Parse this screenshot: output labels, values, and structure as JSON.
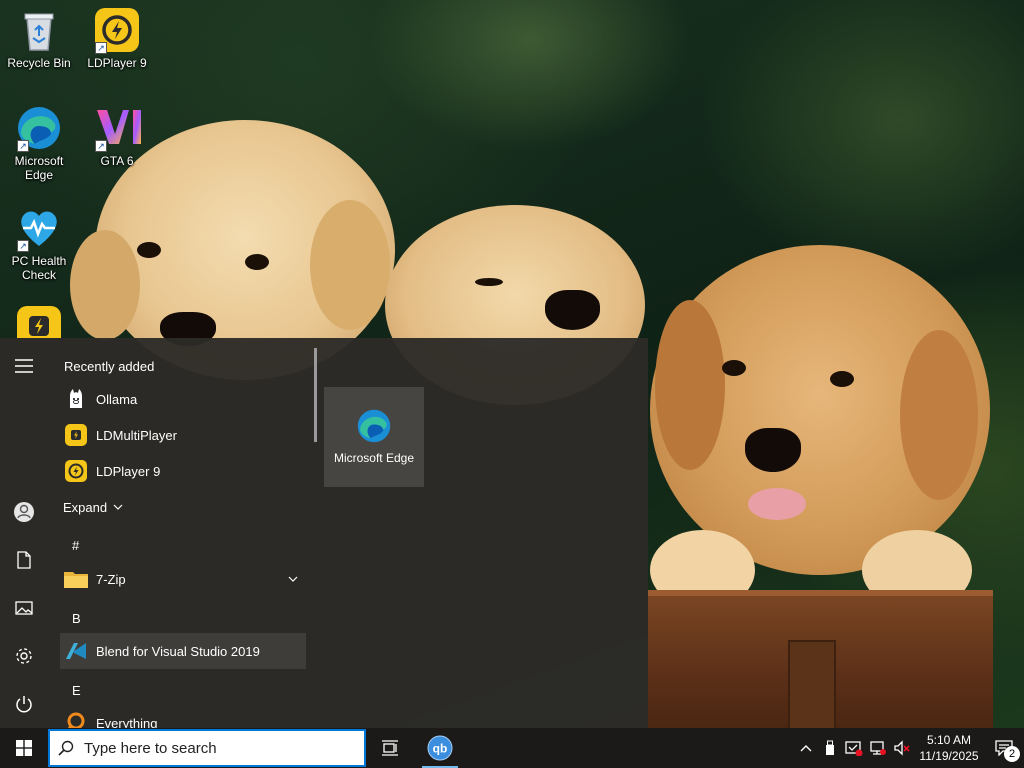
{
  "desktop": {
    "icons": [
      {
        "label": "Recycle Bin",
        "icon": "recycle-bin-icon"
      },
      {
        "label": "LDPlayer 9",
        "icon": "ldplayer-icon"
      },
      {
        "label": "Microsoft Edge",
        "icon": "edge-icon"
      },
      {
        "label": "GTA 6",
        "icon": "gta6-icon"
      },
      {
        "label": "PC Health Check",
        "icon": "pc-health-check-icon"
      },
      {
        "label": "",
        "icon": "ldmultiplayer-icon"
      }
    ]
  },
  "start_menu": {
    "rail": {
      "menu_icon": "hamburger-icon",
      "user_icon": "user-icon",
      "documents_icon": "document-icon",
      "pictures_icon": "pictures-icon",
      "settings_icon": "gear-icon",
      "power_icon": "power-icon"
    },
    "recently_added_title": "Recently added",
    "recent_apps": [
      {
        "label": "Ollama",
        "icon": "ollama-icon"
      },
      {
        "label": "LDMultiPlayer",
        "icon": "ldmultiplayer-icon"
      },
      {
        "label": "LDPlayer 9",
        "icon": "ldplayer-icon"
      }
    ],
    "expand_label": "Expand",
    "groups": [
      {
        "letter": "#",
        "apps": [
          {
            "label": "7-Zip",
            "icon": "folder-icon",
            "expandable": true
          }
        ]
      },
      {
        "letter": "B",
        "apps": [
          {
            "label": "Blend for Visual Studio 2019",
            "icon": "blend-icon"
          }
        ]
      },
      {
        "letter": "E",
        "apps": [
          {
            "label": "Everything",
            "icon": "everything-icon"
          }
        ]
      }
    ],
    "tiles": [
      {
        "label": "Microsoft Edge",
        "icon": "edge-icon"
      }
    ]
  },
  "taskbar": {
    "start_icon": "windows-logo-icon",
    "search_placeholder": "Type here to search",
    "task_view_icon": "task-view-icon",
    "pinned": [
      {
        "icon": "qbittorrent-icon",
        "label": "qb"
      }
    ],
    "tray": {
      "time": "5:10 AM",
      "date": "11/19/2025",
      "notification_count": "2"
    }
  },
  "colors": {
    "accent": "#0078d7",
    "start_menu_bg": "#2d2b28",
    "taskbar_bg": "#1c1a19",
    "ldplayer_yellow": "#f5c518"
  }
}
